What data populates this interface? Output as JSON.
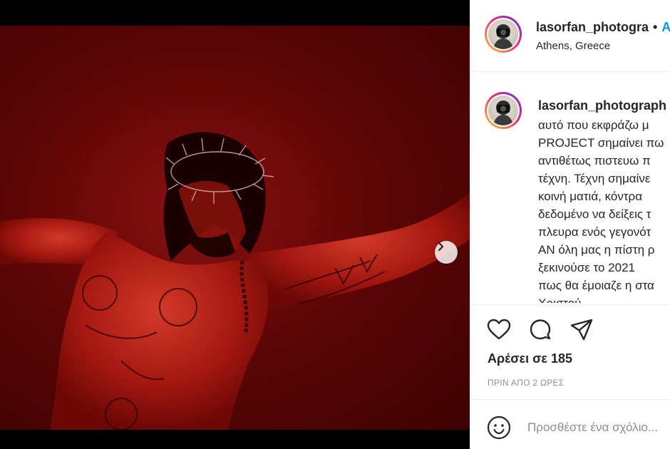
{
  "post": {
    "slide_count": 5,
    "active_slide": 1
  },
  "header": {
    "username": "lasorfan_photogra",
    "separator": "•",
    "follow_label": "Α",
    "location": "Athens, Greece"
  },
  "caption": {
    "username": "lasorfan_photograph",
    "lines": [
      "αυτό που εκφράζω μ",
      "PROJECT σημαίνει πω",
      "αντιθέτως πιστευω π",
      "τέχνη. Τέχνη σημαίνε",
      "κοινή ματιά, κόντρα",
      "δεδομένο να δείξεις τ",
      "πλευρα ενός γεγονότ",
      "ΑΝ όλη μας η πίστη ρ",
      "ξεκινούσε το 2021",
      "πως θα έμοιαζε η στα",
      "Χριστού"
    ]
  },
  "actions": {
    "icons": [
      "heart-icon",
      "comment-icon",
      "share-icon"
    ]
  },
  "likes_text": "Αρέσει σε 185",
  "timestamp": "ΠΡΙΝ ΑΠΟ 2 ΩΡΕΣ",
  "comment": {
    "placeholder": "Προσθέστε ένα σχόλιο..."
  },
  "colors": {
    "accent": "#0095f6",
    "text": "#262626",
    "muted": "#8e8e8e"
  }
}
